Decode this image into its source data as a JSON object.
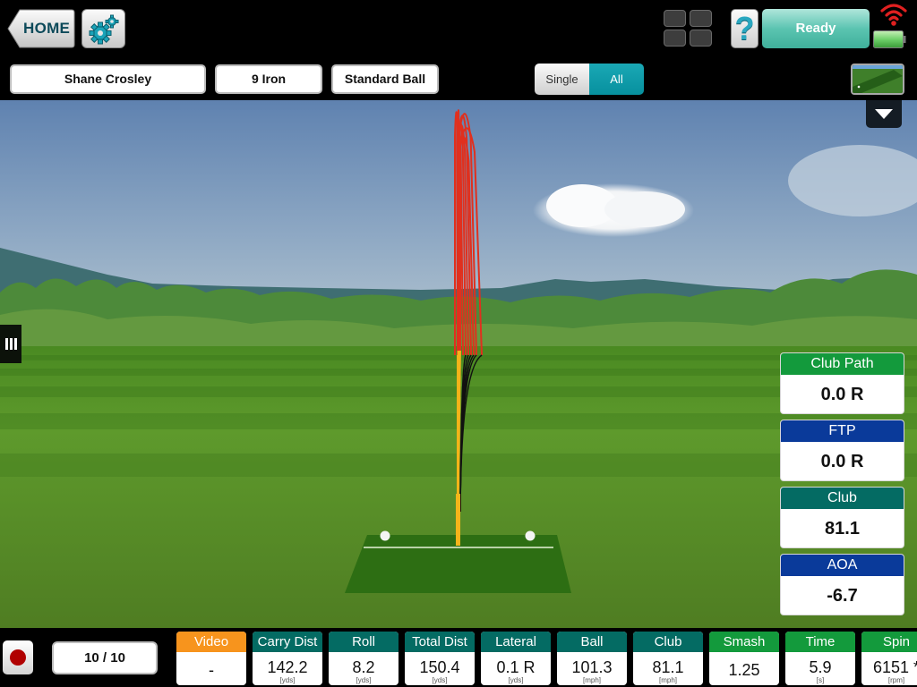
{
  "topbar": {
    "home_label": "HOME",
    "status_label": "Ready",
    "help_label": "?",
    "icons": {
      "settings": "gear-icon",
      "layout": "grid-icon",
      "wifi": "wifi-icon",
      "battery": "battery-icon"
    },
    "wifi_color": "#e02020",
    "battery_color": "#6fd06a"
  },
  "selectors": {
    "player": "Shane Crosley",
    "club": "9 Iron",
    "ball": "Standard Ball"
  },
  "view_toggle": {
    "options": [
      "Single",
      "All"
    ],
    "selected": "All"
  },
  "right_panel": {
    "cards": [
      {
        "label": "Club Path",
        "value": "0.0 R",
        "color": "#139a3c"
      },
      {
        "label": "FTP",
        "value": "0.0 R",
        "color": "#0a3a9a"
      },
      {
        "label": "Club",
        "value": "81.1",
        "color": "#046b63"
      },
      {
        "label": "AOA",
        "value": "-6.7",
        "color": "#0a3a9a"
      }
    ]
  },
  "bottom": {
    "shot_counter": "10 / 10",
    "stats": [
      {
        "label": "Video",
        "value": "-",
        "unit": "",
        "color": "#f7941d"
      },
      {
        "label": "Carry Dist",
        "value": "142.2",
        "unit": "[yds]",
        "color": "#046b63"
      },
      {
        "label": "Roll",
        "value": "8.2",
        "unit": "[yds]",
        "color": "#046b63"
      },
      {
        "label": "Total Dist",
        "value": "150.4",
        "unit": "[yds]",
        "color": "#046b63"
      },
      {
        "label": "Lateral",
        "value": "0.1 R",
        "unit": "[yds]",
        "color": "#046b63"
      },
      {
        "label": "Ball",
        "value": "101.3",
        "unit": "[mph]",
        "color": "#046b63"
      },
      {
        "label": "Club",
        "value": "81.1",
        "unit": "[mph]",
        "color": "#046b63"
      },
      {
        "label": "Smash",
        "value": "1.25",
        "unit": "",
        "color": "#139a3c"
      },
      {
        "label": "Time",
        "value": "5.9",
        "unit": "[s]",
        "color": "#139a3c"
      },
      {
        "label": "Spin",
        "value": "6151 *",
        "unit": "[rpm]",
        "color": "#139a3c"
      }
    ]
  },
  "scene": {
    "trajectory_count": 10,
    "trajectory_colors": {
      "flight": "#e0301e",
      "rise": "#f5b41a",
      "roll": "#111111"
    }
  }
}
